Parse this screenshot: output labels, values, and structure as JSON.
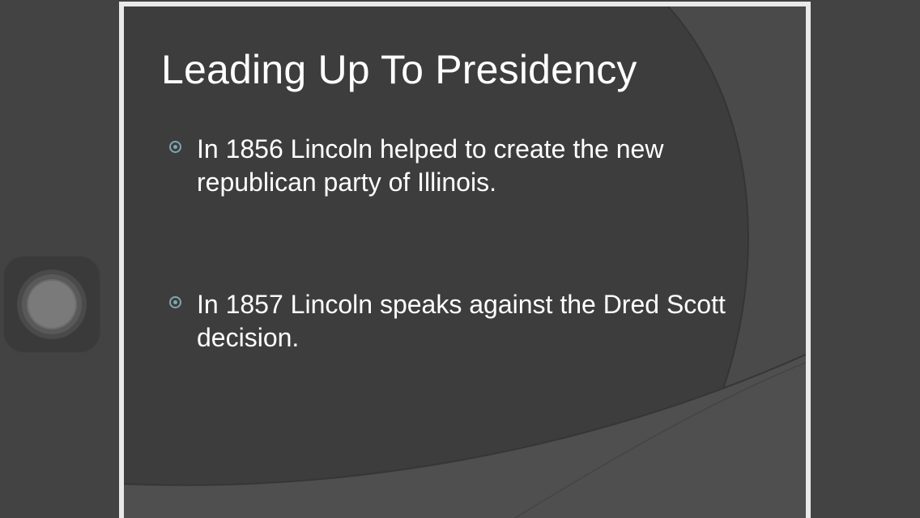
{
  "slide": {
    "title": "Leading Up To Presidency",
    "bullets": [
      {
        "text": "In 1856 Lincoln helped to create the new republican party of Illinois."
      },
      {
        "text": "In 1857 Lincoln speaks against the Dred Scott decision."
      }
    ]
  },
  "colors": {
    "slide_background": "#3d3d3d",
    "swoosh": "#4f4f4f",
    "frame": "#e9e9e9",
    "bullet_accent": "#7fa6b2",
    "text": "#ffffff"
  },
  "icons": {
    "bullet": "circle-dot-icon",
    "assistive_touch": "assistive-touch-icon"
  }
}
